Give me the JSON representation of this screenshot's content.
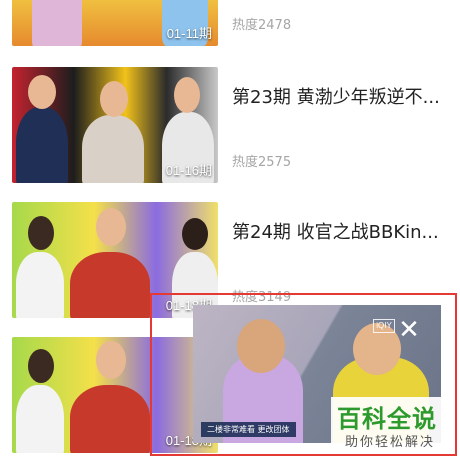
{
  "items": [
    {
      "title": "",
      "heat": "热度2478",
      "episode": "01-11期"
    },
    {
      "title": "第23期 黄渤少年叛逆不...",
      "heat": "热度2575",
      "episode": "01-16期"
    },
    {
      "title": "第24期 收官之战BBKin...",
      "heat": "热度3149",
      "episode": "01-18期"
    },
    {
      "title": "",
      "heat": "",
      "episode": "01-18期"
    }
  ],
  "floating_player": {
    "close_icon": "close-icon",
    "logo_text": "iQIY",
    "caption": "二楼非常难看 更改团体"
  },
  "watermark": {
    "main": "百科全说",
    "sub": "助你轻松解决"
  },
  "colors": {
    "highlight_border": "#e53935",
    "watermark_green": "#2d9a2d",
    "heat_gray": "#a6a6a6"
  }
}
